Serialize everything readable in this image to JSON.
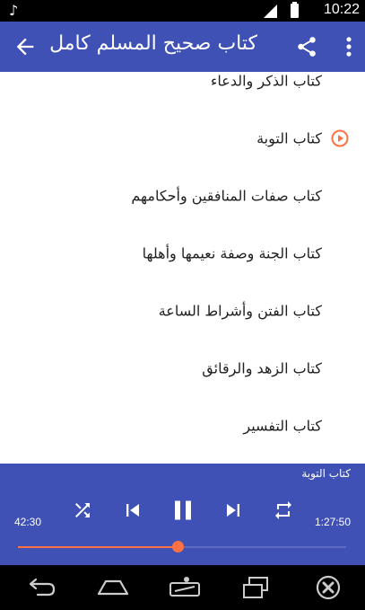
{
  "status_bar": {
    "time": "10:22",
    "icons": [
      "music-note-icon",
      "signal-icon",
      "battery-icon"
    ]
  },
  "app_bar": {
    "title": "كتاب صحيح المسلم كامل",
    "icons": [
      "back-arrow-icon",
      "share-icon",
      "more-vert-icon"
    ],
    "color": "#3f51b5"
  },
  "chapters": [
    {
      "label": "كتاب الذكر والدعاء",
      "playing": false
    },
    {
      "label": "كتاب التوبة",
      "playing": true
    },
    {
      "label": "كتاب صفات المنافقين وأحكامهم",
      "playing": false
    },
    {
      "label": "كتاب الجنة وصفة نعيمها وأهلها",
      "playing": false
    },
    {
      "label": "كتاب الفتن وأشراط الساعة",
      "playing": false
    },
    {
      "label": "كتاب الزهد والرقائق",
      "playing": false
    },
    {
      "label": "كتاب التفسير",
      "playing": false
    }
  ],
  "player": {
    "now_playing": "كتاب التوبة",
    "elapsed": "42:30",
    "duration": "1:27:50",
    "progress": 0.485,
    "controls": [
      "shuffle-icon",
      "skip-previous-icon",
      "pause-icon",
      "skip-next-icon",
      "repeat-icon"
    ],
    "accent": "#ff7043"
  },
  "nav_bar": {
    "icons": [
      "nav-back-icon",
      "home-icon",
      "screen-cast-icon",
      "recent-apps-icon",
      "close-icon"
    ]
  }
}
